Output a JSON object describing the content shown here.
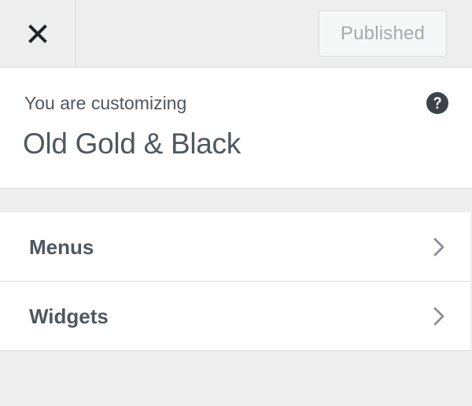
{
  "header": {
    "close_icon": "close-x-icon",
    "publish_label": "Published"
  },
  "info": {
    "label": "You are customizing",
    "site_title": "Old Gold & Black",
    "help_icon": "question-circle-icon"
  },
  "sections": [
    {
      "label": "Menus",
      "icon": "chevron-right-icon"
    },
    {
      "label": "Widgets",
      "icon": "chevron-right-icon"
    }
  ],
  "colors": {
    "background": "#eeeeee",
    "panel": "#ffffff",
    "text": "#50575e",
    "muted": "#a7aaad",
    "border": "#dcdcde",
    "icon": "#1d2327"
  }
}
